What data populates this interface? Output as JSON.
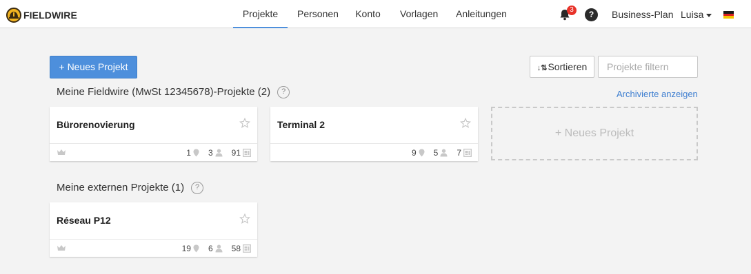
{
  "app": {
    "brand": "FIELDWIRE"
  },
  "nav": {
    "tabs": [
      {
        "label": "Projekte",
        "active": true
      },
      {
        "label": "Personen"
      },
      {
        "label": "Konto"
      },
      {
        "label": "Vorlagen"
      },
      {
        "label": "Anleitungen"
      }
    ],
    "notification_count": "3",
    "help_symbol": "?",
    "plan_label": "Business-Plan",
    "user_name": "Luisa",
    "language_flag_icon": "flag-de-icon",
    "flag_colors": [
      "#1a1a1a",
      "#dd2020",
      "#f5c400"
    ]
  },
  "toolbar": {
    "new_project_label": "+ Neues Projekt",
    "sort_label": "Sortieren",
    "filter_placeholder": "Projekte filtern",
    "accent_color": "#4d8fdc"
  },
  "sections": [
    {
      "title": "Meine Fieldwire (MwSt 12345678)-Projekte (2)",
      "archived_link": "Archivierte anzeigen",
      "projects": [
        {
          "name": "Bürorenovierung",
          "owner_crown": true,
          "locations": "1",
          "people": "3",
          "sheets": "91"
        },
        {
          "name": "Terminal 2",
          "owner_crown": false,
          "locations": "9",
          "people": "5",
          "sheets": "7"
        }
      ],
      "new_project_placeholder": "+ Neues Projekt"
    },
    {
      "title": "Meine externen Projekte (1)",
      "projects": [
        {
          "name": "Réseau P12",
          "owner_crown": true,
          "locations": "19",
          "people": "6",
          "sheets": "58"
        }
      ]
    }
  ]
}
